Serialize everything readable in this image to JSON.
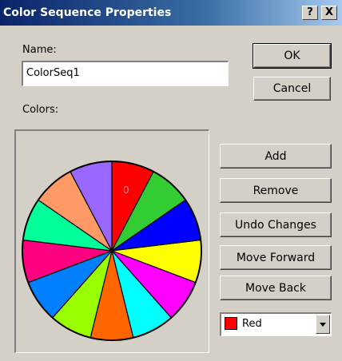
{
  "window": {
    "title": "Color Sequence Properties",
    "help_label": "?",
    "close_label": "X"
  },
  "form": {
    "name_label": "Name:",
    "name_value": "ColorSeq1",
    "colors_label": "Colors:"
  },
  "buttons": {
    "ok": "OK",
    "cancel": "Cancel",
    "add": "Add",
    "remove": "Remove",
    "undo": "Undo Changes",
    "forward": "Move Forward",
    "back": "Move Back"
  },
  "wheel": {
    "selected_index_label": "0",
    "segments": [
      {
        "name": "red",
        "color": "#ff0000"
      },
      {
        "name": "green",
        "color": "#33cc33"
      },
      {
        "name": "blue",
        "color": "#0000ff"
      },
      {
        "name": "yellow",
        "color": "#ffff00"
      },
      {
        "name": "magenta",
        "color": "#ff00ff"
      },
      {
        "name": "cyan",
        "color": "#00ffff"
      },
      {
        "name": "orange",
        "color": "#ff6600"
      },
      {
        "name": "yellow-green",
        "color": "#99ff00"
      },
      {
        "name": "azure",
        "color": "#0080ff"
      },
      {
        "name": "pink",
        "color": "#ff0080"
      },
      {
        "name": "aquamarine",
        "color": "#00ff99"
      },
      {
        "name": "light-orange",
        "color": "#ff9966"
      },
      {
        "name": "lavender",
        "color": "#9966ff"
      }
    ]
  },
  "color_select": {
    "value": "Red",
    "swatch": "#ff0000"
  }
}
